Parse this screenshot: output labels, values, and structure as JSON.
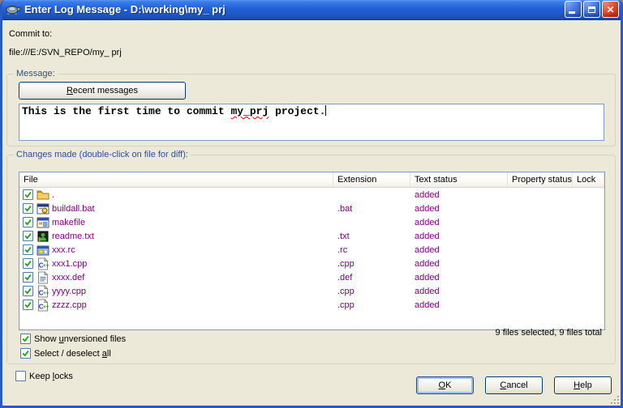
{
  "titlebar": {
    "title": "Enter Log Message - D:\\working\\my_ prj",
    "icons": [
      "tortoisesvn-turtle-icon",
      "minimize-icon",
      "maximize-icon",
      "close-icon"
    ]
  },
  "header": {
    "commit_to_label": "Commit to:",
    "repo_url": "file:///E:/SVN_REPO/my_ prj"
  },
  "message": {
    "group_label": "Message:",
    "recent_button": {
      "pre": "",
      "key": "R",
      "post": "ecent messages"
    },
    "text": {
      "before": "This is the first time to commit ",
      "misspelled": "my_prj",
      "after": " project."
    }
  },
  "changes": {
    "group_label": "Changes made (double-click on file for diff):",
    "columns": [
      "File",
      "Extension",
      "Text status",
      "Property status",
      "Lock"
    ],
    "rows": [
      {
        "checked": true,
        "icon": "folder-icon",
        "file": ".",
        "extension": "",
        "text_status": "added",
        "property_status": "",
        "lock": ""
      },
      {
        "checked": true,
        "icon": "batch-file-icon",
        "file": "buildall.bat",
        "extension": ".bat",
        "text_status": "added",
        "property_status": "",
        "lock": ""
      },
      {
        "checked": true,
        "icon": "makefile-icon",
        "file": "makefile",
        "extension": "",
        "text_status": "added",
        "property_status": "",
        "lock": ""
      },
      {
        "checked": true,
        "icon": "readme-file-icon",
        "file": "readme.txt",
        "extension": ".txt",
        "text_status": "added",
        "property_status": "",
        "lock": ""
      },
      {
        "checked": true,
        "icon": "resource-file-icon",
        "file": "xxx.rc",
        "extension": ".rc",
        "text_status": "added",
        "property_status": "",
        "lock": ""
      },
      {
        "checked": true,
        "icon": "cpp-file-icon",
        "file": "xxx1.cpp",
        "extension": ".cpp",
        "text_status": "added",
        "property_status": "",
        "lock": ""
      },
      {
        "checked": true,
        "icon": "def-file-icon",
        "file": "xxxx.def",
        "extension": ".def",
        "text_status": "added",
        "property_status": "",
        "lock": ""
      },
      {
        "checked": true,
        "icon": "cpp-file-icon",
        "file": "yyyy.cpp",
        "extension": ".cpp",
        "text_status": "added",
        "property_status": "",
        "lock": ""
      },
      {
        "checked": true,
        "icon": "cpp-file-icon",
        "file": "zzzz.cpp",
        "extension": ".cpp",
        "text_status": "added",
        "property_status": "",
        "lock": ""
      }
    ],
    "summary": "9 files selected, 9 files total",
    "show_unversioned": {
      "pre": "Show ",
      "key": "u",
      "post": "nversioned files",
      "checked": true
    },
    "select_all": {
      "pre": "Select / deselect ",
      "key": "a",
      "post": "ll",
      "checked": true
    }
  },
  "footer": {
    "keep_locks": {
      "pre": "Keep ",
      "key": "l",
      "post": "ocks",
      "checked": false
    },
    "ok": {
      "pre": "",
      "key": "O",
      "post": "K"
    },
    "cancel": {
      "pre": "",
      "key": "C",
      "post": "ancel"
    },
    "help": {
      "pre": "",
      "key": "H",
      "post": "elp"
    }
  },
  "colors": {
    "titlebar_blue": "#2361D8",
    "window_border": "#295BC8",
    "dialog_background": "#ECE9D8",
    "group_label_blue": "#2B4EA2",
    "added_item_purple": "#800080",
    "checkbox_check_green": "#1FA31F",
    "close_button_red": "#C22B0C"
  }
}
